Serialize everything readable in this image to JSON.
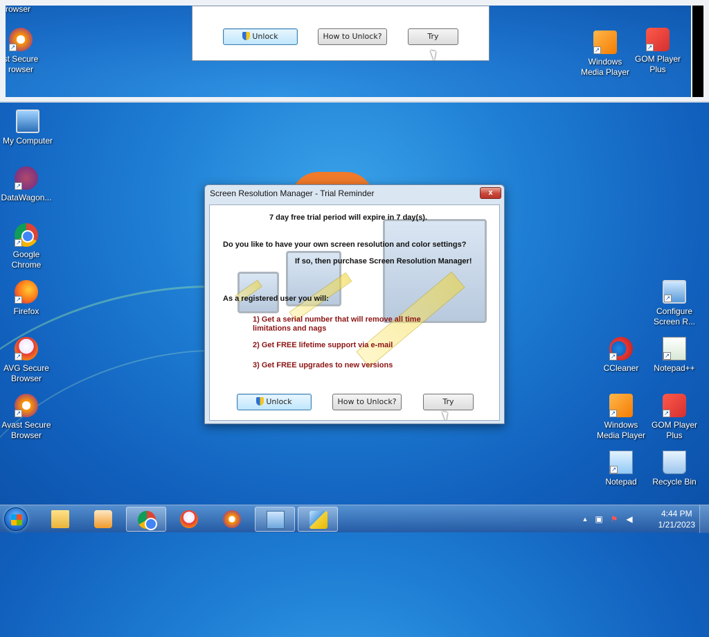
{
  "preview": {
    "icons": [
      {
        "label": "rowser"
      },
      {
        "label": "st Secure\nrowser"
      },
      {
        "label": "Windows\nMedia Player"
      },
      {
        "label": "GOM Player\nPlus"
      }
    ],
    "buttons": {
      "unlock": "Unlock",
      "how": "How to Unlock?",
      "try": "Try"
    }
  },
  "desktop": {
    "left_icons": [
      {
        "label": "My Computer"
      },
      {
        "label": "DataWagon..."
      },
      {
        "label": "Google\nChrome"
      },
      {
        "label": "Firefox"
      },
      {
        "label": "AVG Secure\nBrowser"
      },
      {
        "label": "Avast Secure\nBrowser"
      }
    ],
    "right_icons": [
      {
        "label": "Configure\nScreen R..."
      },
      {
        "label": "CCleaner"
      },
      {
        "label": "Notepad++"
      },
      {
        "label": "Windows\nMedia Player"
      },
      {
        "label": "GOM Player\nPlus"
      },
      {
        "label": "Notepad"
      },
      {
        "label": "Recycle Bin"
      }
    ]
  },
  "dialog": {
    "title": "Screen Resolution Manager - Trial Reminder",
    "close_label": "x",
    "trial_line": "7 day free trial period will expire in 7 day(s).",
    "question": "Do you like to have your own screen resolution and color settings?",
    "purchase": "If so, then purchase Screen Resolution Manager!",
    "registered": "As a registered user you will:",
    "benefits": [
      "1) Get a serial number that will remove all time",
      "limitations and nags",
      "2) Get FREE lifetime support via e-mail",
      "3) Get FREE upgrades to new versions"
    ],
    "buttons": {
      "unlock": "Unlock",
      "how": "How to Unlock?",
      "try": "Try"
    }
  },
  "taskbar": {
    "time": "4:44 PM",
    "date": "1/21/2023",
    "tray_chevron": "▲"
  }
}
